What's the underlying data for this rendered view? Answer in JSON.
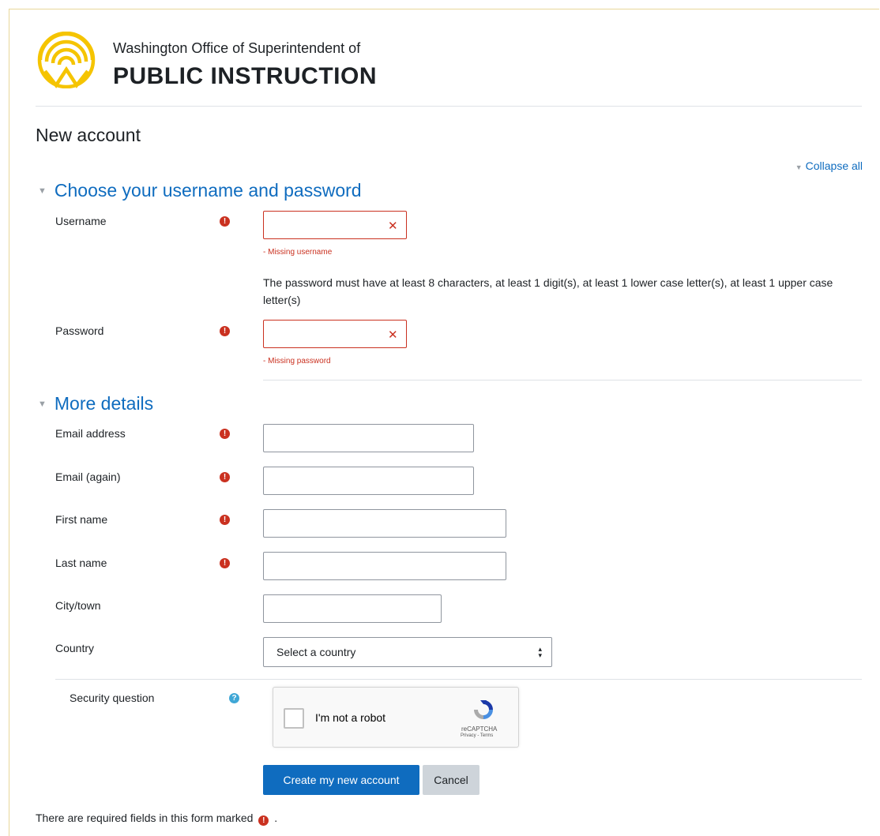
{
  "brand": {
    "org_line": "Washington Office of Superintendent of",
    "title_line": "PUBLIC INSTRUCTION",
    "logo_icon": "ospi-rings-logo-icon",
    "accent_color": "#f5c400"
  },
  "page": {
    "title": "New account"
  },
  "collapse_all_label": "Collapse all",
  "sections": {
    "credentials": {
      "title": "Choose your username and password",
      "username_label": "Username",
      "username_error": "- Missing username",
      "password_policy": "The password must have at least 8 characters, at least 1 digit(s), at least 1 lower case letter(s), at least 1 upper case letter(s)",
      "password_label": "Password",
      "password_error": "- Missing password"
    },
    "details": {
      "title": "More details",
      "email_label": "Email address",
      "email_again_label": "Email (again)",
      "first_name_label": "First name",
      "last_name_label": "Last name",
      "city_label": "City/town",
      "country_label": "Country",
      "country_selected": "Select a country"
    }
  },
  "security": {
    "label": "Security question",
    "captcha_text": "I'm not a robot",
    "captcha_brand": "reCAPTCHA",
    "captcha_links": "Privacy - Terms"
  },
  "buttons": {
    "submit": "Create my new account",
    "cancel": "Cancel"
  },
  "footer": {
    "required_note": "There are required fields in this form marked",
    "required_note_end": "."
  },
  "colors": {
    "link": "#0f6cbf",
    "error": "#ca3120",
    "help": "#3fa7d6"
  }
}
